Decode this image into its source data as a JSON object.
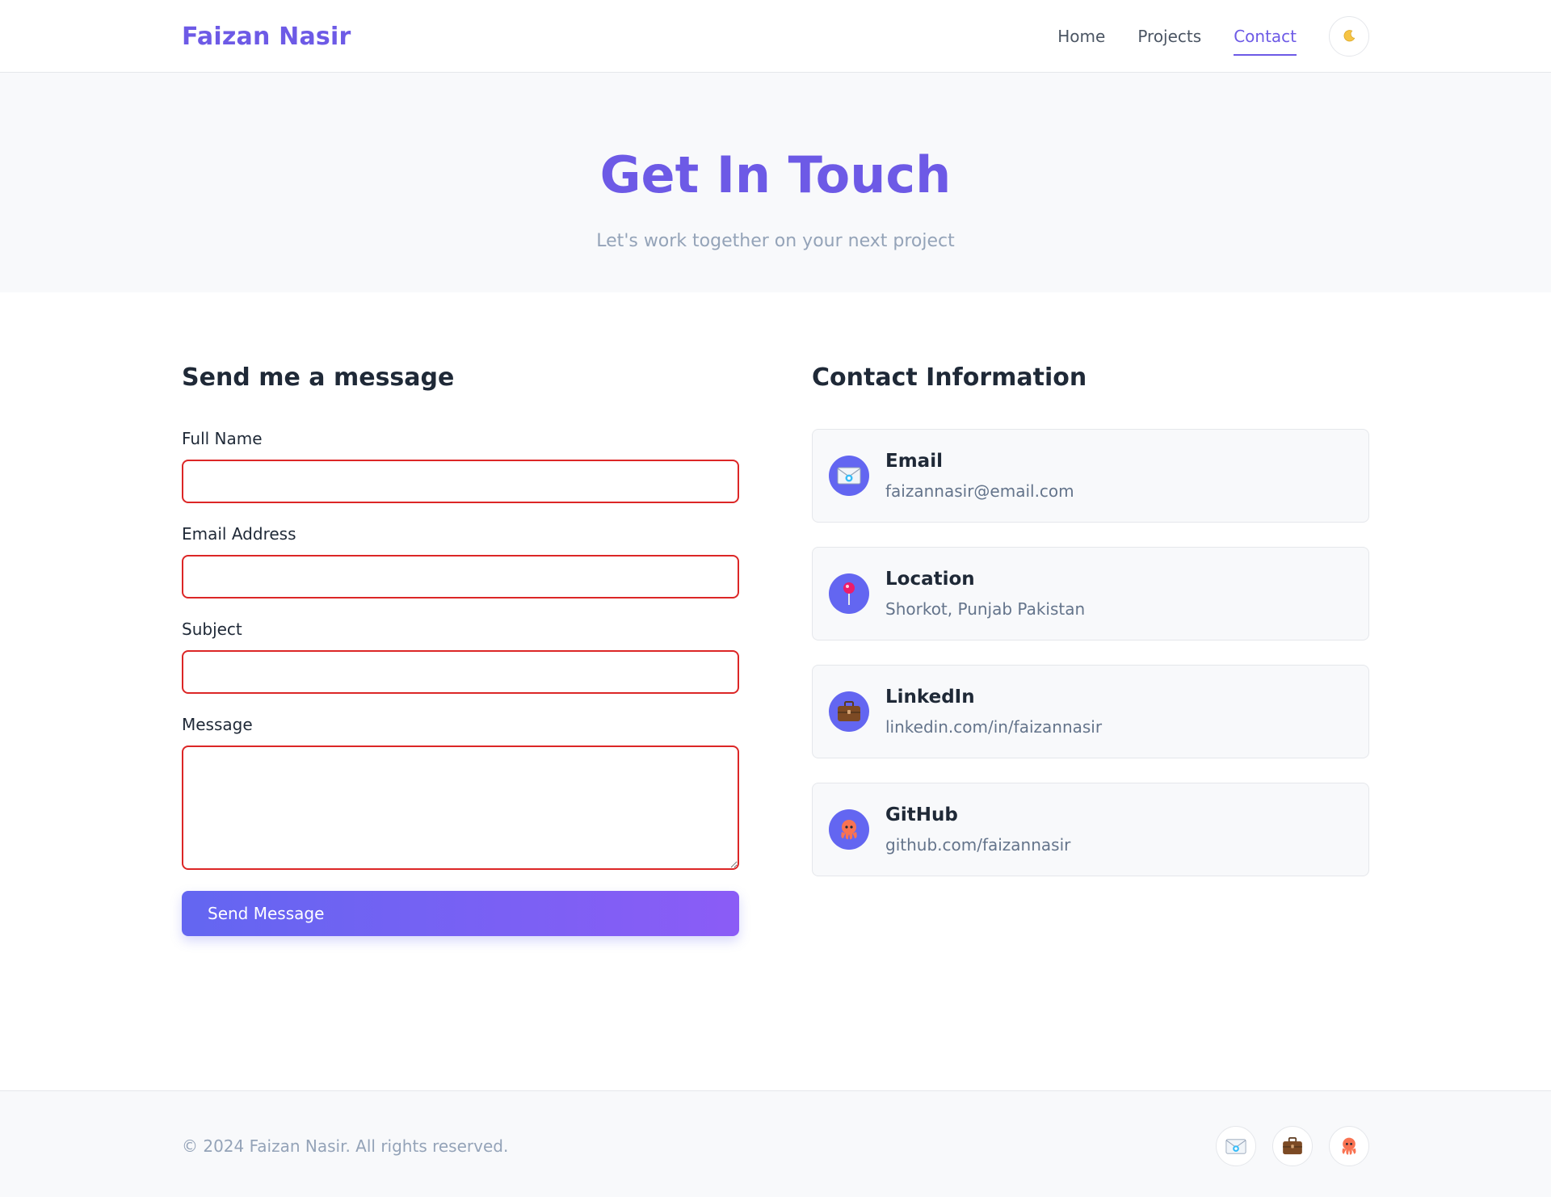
{
  "header": {
    "brand": "Faizan Nasir",
    "nav": [
      {
        "label": "Home"
      },
      {
        "label": "Projects"
      },
      {
        "label": "Contact"
      }
    ],
    "theme_toggle_icon": "moon-icon"
  },
  "hero": {
    "title": "Get In Touch",
    "subtitle": "Let's work together on your next project"
  },
  "form": {
    "title": "Send me a message",
    "fields": [
      {
        "label": "Full Name",
        "value": ""
      },
      {
        "label": "Email Address",
        "value": ""
      },
      {
        "label": "Subject",
        "value": ""
      },
      {
        "label": "Message",
        "value": ""
      }
    ],
    "submit_label": "Send Message"
  },
  "contact": {
    "title": "Contact Information",
    "cards": [
      {
        "title": "Email",
        "value": "faizannasir@email.com",
        "icon": "envelope-icon"
      },
      {
        "title": "Location",
        "value": "Shorkot, Punjab Pakistan",
        "icon": "pushpin-icon"
      },
      {
        "title": "LinkedIn",
        "value": "linkedin.com/in/faizannasir",
        "icon": "briefcase-icon"
      },
      {
        "title": "GitHub",
        "value": "github.com/faizannasir",
        "icon": "octopus-icon"
      }
    ]
  },
  "footer": {
    "copyright": "© 2024 Faizan Nasir. All rights reserved.",
    "socials": [
      "envelope-icon",
      "briefcase-icon",
      "octopus-icon"
    ]
  },
  "colors": {
    "accent": "#6d5ae6",
    "error_border": "#dc2626",
    "button_gradient_start": "#6366f1",
    "button_gradient_end": "#8b5cf6"
  }
}
